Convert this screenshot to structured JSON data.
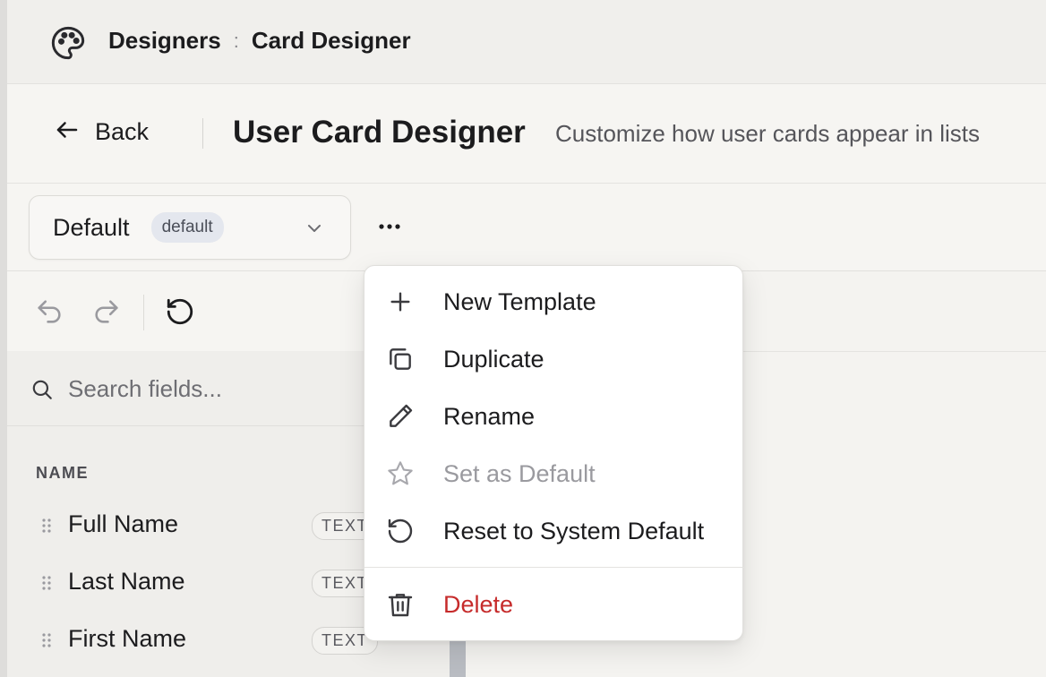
{
  "breadcrumb": {
    "section": "Designers",
    "separator": ":",
    "current": "Card Designer"
  },
  "header": {
    "back_label": "Back",
    "title": "User Card Designer",
    "subtitle": "Customize how user cards appear in lists"
  },
  "template_select": {
    "value": "Default",
    "badge": "default"
  },
  "search": {
    "placeholder": "Search fields..."
  },
  "fields": {
    "section_label": "NAME",
    "items": [
      {
        "label": "Full Name",
        "type": "TEXT"
      },
      {
        "label": "Last Name",
        "type": "TEXT"
      },
      {
        "label": "First Name",
        "type": "TEXT"
      }
    ]
  },
  "menu": {
    "items": [
      {
        "label": "New Template",
        "icon": "plus-icon"
      },
      {
        "label": "Duplicate",
        "icon": "copy-icon"
      },
      {
        "label": "Rename",
        "icon": "pencil-icon"
      },
      {
        "label": "Set as Default",
        "icon": "star-icon",
        "disabled": true
      },
      {
        "label": "Reset to System Default",
        "icon": "reset-icon"
      }
    ],
    "danger_item": {
      "label": "Delete",
      "icon": "trash-icon",
      "color": "#c62b2b"
    }
  }
}
